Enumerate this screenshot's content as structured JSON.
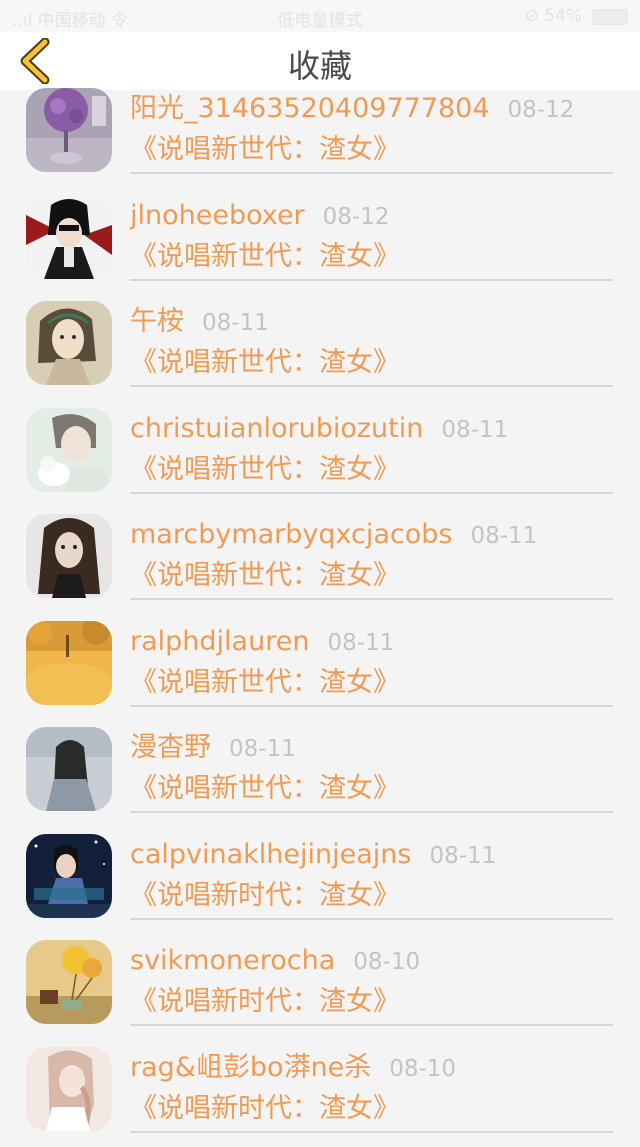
{
  "status_bar": {
    "left": "..ıl 中国移动 令",
    "center": "低电量模式",
    "right": "⊘ 54%"
  },
  "header": {
    "title": "收藏",
    "back_icon": "chevron-left-icon"
  },
  "colors": {
    "accent": "#f09b54",
    "back_icon": "#f6c332",
    "date": "#c3c3c3",
    "title_text": "#4a4a4a"
  },
  "favorites": [
    {
      "name": "阳光_31463520409777804",
      "date": "08-12",
      "title": "《说唱新世代：渣女》",
      "avatar": "avatar-purple-flowers"
    },
    {
      "name": "jlnoheeboxer",
      "date": "08-12",
      "title": "《说唱新世代：渣女》",
      "avatar": "avatar-anime-boy"
    },
    {
      "name": "午桉",
      "date": "08-11",
      "title": "《说唱新世代：渣女》",
      "avatar": "avatar-painted-girl"
    },
    {
      "name": "christuianlorubiozutin",
      "date": "08-11",
      "title": "《说唱新世代：渣女》",
      "avatar": "avatar-boy-with-cat"
    },
    {
      "name": "marcbymarbyqxcjacobs",
      "date": "08-11",
      "title": "《说唱新世代：渣女》",
      "avatar": "avatar-dark-hair-woman"
    },
    {
      "name": "ralphdjlauren",
      "date": "08-11",
      "title": "《说唱新世代：渣女》",
      "avatar": "avatar-autumn-leaves"
    },
    {
      "name": "漫杳野",
      "date": "08-11",
      "title": "《说唱新世代：渣女》",
      "avatar": "avatar-girl-back"
    },
    {
      "name": "calpvinaklhejinjeajns",
      "date": "08-11",
      "title": "《说唱新时代：渣女》",
      "avatar": "avatar-couple"
    },
    {
      "name": "svikmonerocha",
      "date": "08-10",
      "title": "《说唱新时代：渣女》",
      "avatar": "avatar-balloons"
    },
    {
      "name": "rag&岨彭bo漭ne杀",
      "date": "08-10",
      "title": "《说唱新时代：渣女》",
      "avatar": "avatar-girl-braid"
    }
  ]
}
